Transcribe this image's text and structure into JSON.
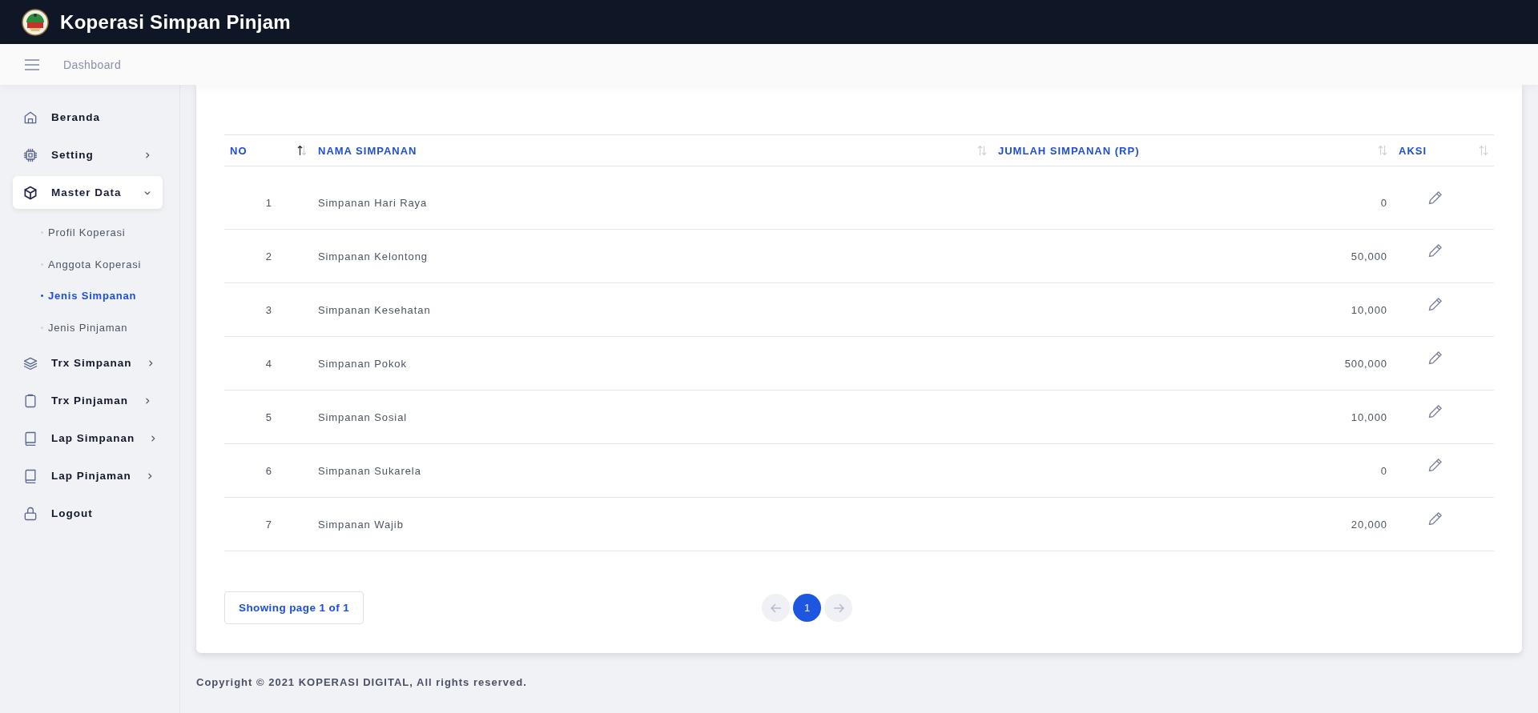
{
  "header": {
    "title": "Koperasi Simpan Pinjam"
  },
  "topbar": {
    "breadcrumb": "Dashboard"
  },
  "sidebar": {
    "items": [
      {
        "label": "Beranda",
        "kind": "link",
        "selected": false
      },
      {
        "label": "Setting",
        "kind": "group",
        "expanded": false,
        "selected": false
      },
      {
        "label": "Master Data",
        "kind": "group",
        "expanded": true,
        "selected": true,
        "children": [
          {
            "label": "Profil Koperasi",
            "selected": false
          },
          {
            "label": "Anggota Koperasi",
            "selected": false
          },
          {
            "label": "Jenis Simpanan",
            "selected": true
          },
          {
            "label": "Jenis Pinjaman",
            "selected": false
          }
        ]
      },
      {
        "label": "Trx Simpanan",
        "kind": "group",
        "expanded": false,
        "selected": false
      },
      {
        "label": "Trx Pinjaman",
        "kind": "group",
        "expanded": false,
        "selected": false
      },
      {
        "label": "Lap Simpanan",
        "kind": "group",
        "expanded": false,
        "selected": false
      },
      {
        "label": "Lap Pinjaman",
        "kind": "group",
        "expanded": false,
        "selected": false
      },
      {
        "label": "Logout",
        "kind": "link",
        "selected": false
      }
    ]
  },
  "table": {
    "columns": [
      {
        "label": "NO",
        "sorted": true
      },
      {
        "label": "NAMA SIMPANAN",
        "sorted": false
      },
      {
        "label": "JUMLAH SIMPANAN (RP)",
        "sorted": false
      },
      {
        "label": "AKSI",
        "sorted": false
      }
    ],
    "rows": [
      {
        "no": "1",
        "name": "Simpanan Hari Raya",
        "amount": "0"
      },
      {
        "no": "2",
        "name": "Simpanan Kelontong",
        "amount": "50,000"
      },
      {
        "no": "3",
        "name": "Simpanan Kesehatan",
        "amount": "10,000"
      },
      {
        "no": "4",
        "name": "Simpanan Pokok",
        "amount": "500,000"
      },
      {
        "no": "5",
        "name": "Simpanan Sosial",
        "amount": "10,000"
      },
      {
        "no": "6",
        "name": "Simpanan Sukarela",
        "amount": "0"
      },
      {
        "no": "7",
        "name": "Simpanan Wajib",
        "amount": "20,000"
      }
    ]
  },
  "pagination": {
    "summary": "Showing page 1 of 1",
    "previous": {
      "disabled": true
    },
    "pages": [
      {
        "label": "1",
        "selected": true
      }
    ],
    "next": {
      "disabled": true
    }
  },
  "footer": {
    "text": "Copyright © 2021 KOPERASI DIGITAL, All rights reserved."
  }
}
